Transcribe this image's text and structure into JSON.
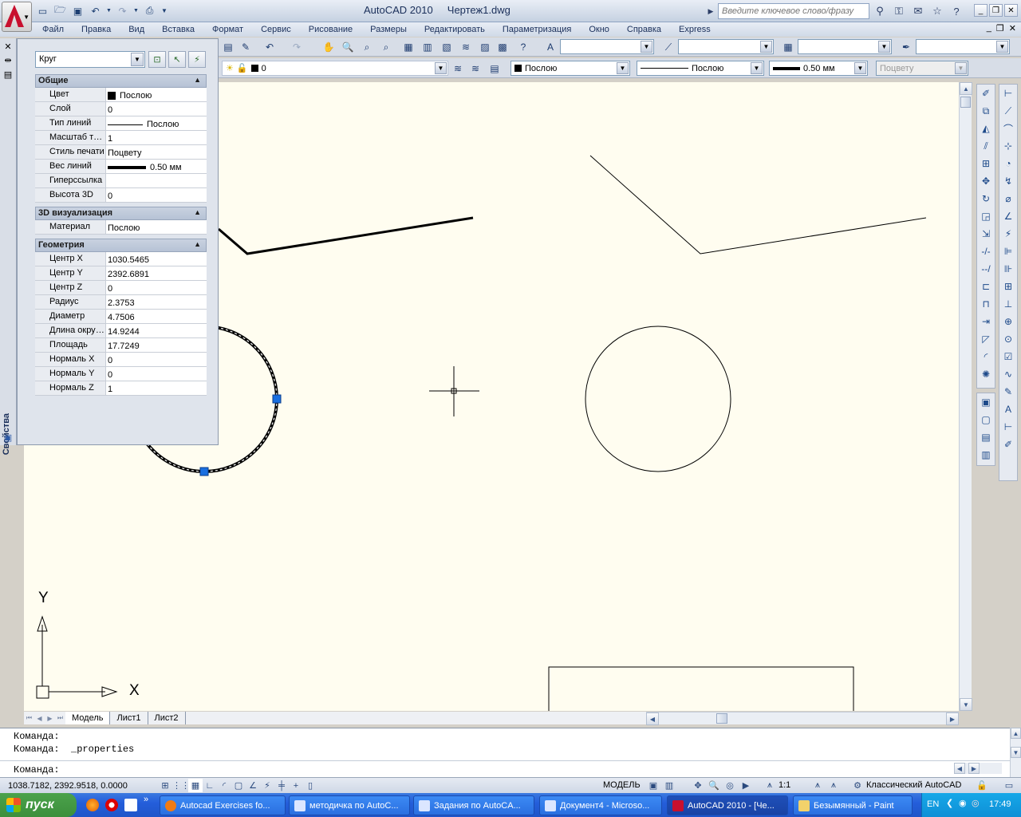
{
  "title": "AutoCAD 2010     Чертеж1.dwg",
  "search": {
    "placeholder": "Введите ключевое слово/фразу"
  },
  "menu": [
    "Файл",
    "Правка",
    "Вид",
    "Вставка",
    "Формат",
    "Сервис",
    "Рисование",
    "Размеры",
    "Редактировать",
    "Параметризация",
    "Окно",
    "Справка",
    "Express"
  ],
  "toolbar": {
    "layer": "0",
    "color": "Послою",
    "linetype": "Послою",
    "lineweight": "0.50 мм",
    "plotstyle": "Поцвету"
  },
  "palette": {
    "title": "Свойства",
    "object": "Круг",
    "groups": [
      {
        "name": "Общие",
        "rows": [
          {
            "key": "Цвет",
            "value": "Послою",
            "swatch": "color"
          },
          {
            "key": "Слой",
            "value": "0"
          },
          {
            "key": "Тип линий",
            "value": "Послою",
            "swatch": "linetype"
          },
          {
            "key": "Масштаб типа...",
            "value": "1"
          },
          {
            "key": "Стиль печати",
            "value": "Поцвету"
          },
          {
            "key": "Вес линий",
            "value": "0.50 мм",
            "swatch": "lineweight"
          },
          {
            "key": "Гиперссылка",
            "value": ""
          },
          {
            "key": "Высота 3D",
            "value": "0"
          }
        ]
      },
      {
        "name": "3D визуализация",
        "rows": [
          {
            "key": "Материал",
            "value": "Послою"
          }
        ]
      },
      {
        "name": "Геометрия",
        "rows": [
          {
            "key": "Центр X",
            "value": "1030.5465"
          },
          {
            "key": "Центр Y",
            "value": "2392.6891"
          },
          {
            "key": "Центр Z",
            "value": "0"
          },
          {
            "key": "Радиус",
            "value": "2.3753"
          },
          {
            "key": "Диаметр",
            "value": "4.7506"
          },
          {
            "key": "Длина окружн...",
            "value": "14.9244"
          },
          {
            "key": "Площадь",
            "value": "17.7249"
          },
          {
            "key": "Нормаль X",
            "value": "0"
          },
          {
            "key": "Нормаль Y",
            "value": "0"
          },
          {
            "key": "Нормаль Z",
            "value": "1"
          }
        ]
      }
    ]
  },
  "ucs": {
    "x": "X",
    "y": "Y"
  },
  "layout_tabs": [
    "Модель",
    "Лист1",
    "Лист2"
  ],
  "command": {
    "line1": "Команда:",
    "line2": "Команда:  _properties",
    "prompt": "Команда:"
  },
  "status": {
    "coords": "1038.7182, 2392.9518, 0.0000",
    "model": "МОДЕЛЬ",
    "scale": "1:1",
    "workspace": "Классический AutoCAD"
  },
  "taskbar": {
    "start": "пуск",
    "tasks": [
      "Autocad Exercises fo...",
      "методичка по AutoC...",
      "Задания по AutoCA...",
      "Документ4 - Microso...",
      "AutoCAD 2010 - [Че...",
      "Безымянный - Paint"
    ],
    "lang": "EN",
    "time": "17:49"
  },
  "colors": {
    "canvas": "#fffdf0",
    "grip": "#1a6fe0",
    "taskbar": "#245edb",
    "start": "#3c8f3c"
  }
}
